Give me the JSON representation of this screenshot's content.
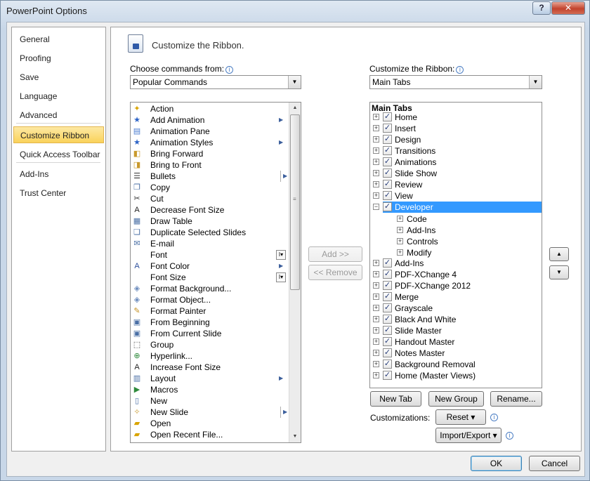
{
  "window": {
    "title": "PowerPoint Options",
    "help_label": "?",
    "close_label": "✕"
  },
  "nav": {
    "items": [
      {
        "label": "General"
      },
      {
        "label": "Proofing"
      },
      {
        "label": "Save"
      },
      {
        "label": "Language"
      },
      {
        "label": "Advanced"
      },
      {
        "label": "Customize Ribbon",
        "selected": true
      },
      {
        "label": "Quick Access Toolbar"
      },
      {
        "label": "Add-Ins"
      },
      {
        "label": "Trust Center"
      }
    ]
  },
  "header": {
    "title": "Customize the Ribbon."
  },
  "left": {
    "label": "Choose commands from:",
    "combo_value": "Popular Commands",
    "commands": [
      {
        "label": "Action",
        "icon": "✦",
        "color": "#d9a400"
      },
      {
        "label": "Add Animation",
        "icon": "★",
        "color": "#2c63c7",
        "submenu": true
      },
      {
        "label": "Animation Pane",
        "icon": "▤",
        "color": "#4a7bd0"
      },
      {
        "label": "Animation Styles",
        "icon": "★",
        "color": "#2c63c7",
        "submenu": true
      },
      {
        "label": "Bring Forward",
        "icon": "◧",
        "color": "#c99a2e"
      },
      {
        "label": "Bring to Front",
        "icon": "◨",
        "color": "#c99a2e"
      },
      {
        "label": "Bullets",
        "icon": "☰",
        "color": "#333333",
        "submenu_box": true
      },
      {
        "label": "Copy",
        "icon": "❐",
        "color": "#4a6fa5"
      },
      {
        "label": "Cut",
        "icon": "✂",
        "color": "#333333"
      },
      {
        "label": "Decrease Font Size",
        "icon": "A",
        "color": "#222222"
      },
      {
        "label": "Draw Table",
        "icon": "▦",
        "color": "#4a6fa5"
      },
      {
        "label": "Duplicate Selected Slides",
        "icon": "❏",
        "color": "#4a6fa5"
      },
      {
        "label": "E-mail",
        "icon": "✉",
        "color": "#4a6fa5"
      },
      {
        "label": "Font",
        "icon": "",
        "color": "#222222",
        "field_box": true
      },
      {
        "label": "Font Color",
        "icon": "A",
        "color": "#2c4f9c",
        "submenu": true
      },
      {
        "label": "Font Size",
        "icon": "",
        "color": "#222222",
        "field_box": true
      },
      {
        "label": "Format Background...",
        "icon": "◈",
        "color": "#6b8bbd"
      },
      {
        "label": "Format Object...",
        "icon": "◈",
        "color": "#6b8bbd"
      },
      {
        "label": "Format Painter",
        "icon": "✎",
        "color": "#c38f1f"
      },
      {
        "label": "From Beginning",
        "icon": "▣",
        "color": "#4a6fa5"
      },
      {
        "label": "From Current Slide",
        "icon": "▣",
        "color": "#4a6fa5"
      },
      {
        "label": "Group",
        "icon": "⬚",
        "color": "#333333"
      },
      {
        "label": "Hyperlink...",
        "icon": "⊕",
        "color": "#2f8a3c"
      },
      {
        "label": "Increase Font Size",
        "icon": "A",
        "color": "#222222"
      },
      {
        "label": "Layout",
        "icon": "▥",
        "color": "#4a6fa5",
        "submenu": true
      },
      {
        "label": "Macros",
        "icon": "▶",
        "color": "#2f8a3c"
      },
      {
        "label": "New",
        "icon": "▯",
        "color": "#4a6fa5"
      },
      {
        "label": "New Slide",
        "icon": "✧",
        "color": "#c99a2e",
        "submenu_box": true
      },
      {
        "label": "Open",
        "icon": "▰",
        "color": "#d9a400"
      },
      {
        "label": "Open Recent File...",
        "icon": "▰",
        "color": "#d9a400"
      }
    ],
    "icons": {
      "submenu": "▶",
      "field": "I▾"
    }
  },
  "middle": {
    "add_label": "Add >>",
    "remove_label": "<< Remove"
  },
  "right": {
    "label": "Customize the Ribbon:",
    "combo_value": "Main Tabs",
    "tree_header": "Main Tabs",
    "tabs": [
      {
        "label": "Home",
        "checked": true
      },
      {
        "label": "Insert",
        "checked": true
      },
      {
        "label": "Design",
        "checked": true
      },
      {
        "label": "Transitions",
        "checked": true
      },
      {
        "label": "Animations",
        "checked": true
      },
      {
        "label": "Slide Show",
        "checked": true
      },
      {
        "label": "Review",
        "checked": true
      },
      {
        "label": "View",
        "checked": true
      },
      {
        "label": "Developer",
        "checked": true,
        "expanded": true,
        "selected": true,
        "groups": [
          {
            "label": "Code"
          },
          {
            "label": "Add-Ins"
          },
          {
            "label": "Controls"
          },
          {
            "label": "Modify"
          }
        ]
      },
      {
        "label": "Add-Ins",
        "checked": true
      },
      {
        "label": "PDF-XChange 4",
        "checked": true
      },
      {
        "label": "PDF-XChange 2012",
        "checked": true
      },
      {
        "label": "Merge",
        "checked": true
      },
      {
        "label": "Grayscale",
        "checked": true
      },
      {
        "label": "Black And White",
        "checked": true
      },
      {
        "label": "Slide Master",
        "checked": true
      },
      {
        "label": "Handout Master",
        "checked": true
      },
      {
        "label": "Notes Master",
        "checked": true
      },
      {
        "label": "Background Removal",
        "checked": true
      },
      {
        "label": "Home (Master Views)",
        "checked": true
      }
    ],
    "new_tab_label": "New Tab",
    "new_group_label": "New Group",
    "rename_label": "Rename...",
    "customizations_label": "Customizations:",
    "reset_label": "Reset ▾",
    "import_export_label": "Import/Export ▾",
    "move_up_icon": "▲",
    "move_down_icon": "▼"
  },
  "footer": {
    "ok_label": "OK",
    "cancel_label": "Cancel"
  }
}
